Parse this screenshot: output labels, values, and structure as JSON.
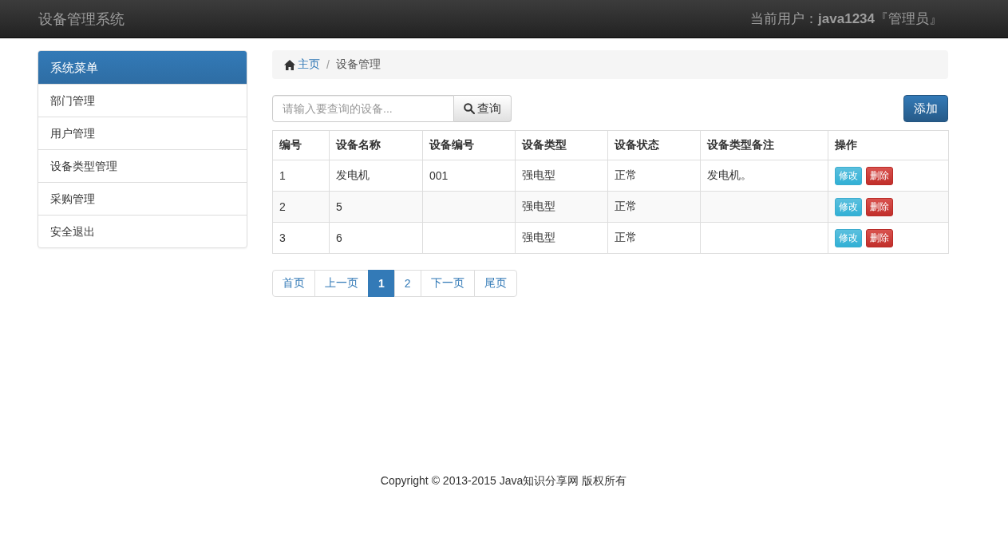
{
  "navbar": {
    "brand": "设备管理系统",
    "user_label": "当前用户：",
    "user_name": "java1234",
    "user_role": "『管理员』"
  },
  "sidebar": {
    "title": "系统菜单",
    "items": [
      {
        "label": "部门管理"
      },
      {
        "label": "用户管理"
      },
      {
        "label": "设备类型管理"
      },
      {
        "label": "采购管理"
      },
      {
        "label": "安全退出"
      }
    ]
  },
  "breadcrumb": [
    {
      "label": "主页",
      "kind": "link"
    },
    {
      "label": "/",
      "kind": "separator"
    },
    {
      "label": "设备管理",
      "kind": "current"
    }
  ],
  "search": {
    "placeholder": "请输入要查询的设备...",
    "button": "查询"
  },
  "add_button": "添加",
  "table": {
    "columns": [
      "编号",
      "设备名称",
      "设备编号",
      "设备类型",
      "设备状态",
      "设备类型备注",
      "操作"
    ],
    "rows": [
      {
        "cells": [
          "1",
          "发电机",
          "001",
          "强电型",
          "正常",
          "发电机。"
        ],
        "actions": [
          {
            "label": "修改",
            "kind": "edit"
          },
          {
            "label": "删除",
            "kind": "delete"
          }
        ]
      },
      {
        "cells": [
          "2",
          "5",
          "",
          "强电型",
          "正常",
          ""
        ],
        "actions": [
          {
            "label": "修改",
            "kind": "edit"
          },
          {
            "label": "删除",
            "kind": "delete"
          }
        ]
      },
      {
        "cells": [
          "3",
          "6",
          "",
          "强电型",
          "正常",
          ""
        ],
        "actions": [
          {
            "label": "修改",
            "kind": "edit"
          },
          {
            "label": "删除",
            "kind": "delete"
          }
        ]
      }
    ]
  },
  "pagination": [
    {
      "label": "首页",
      "selected": false
    },
    {
      "label": "上一页",
      "selected": false
    },
    {
      "label": "1",
      "selected": true
    },
    {
      "label": "2",
      "selected": false
    },
    {
      "label": "下一页",
      "selected": false
    },
    {
      "label": "尾页",
      "selected": false
    }
  ],
  "footer": "Copyright © 2013-2015 Java知识分享网 版权所有"
}
